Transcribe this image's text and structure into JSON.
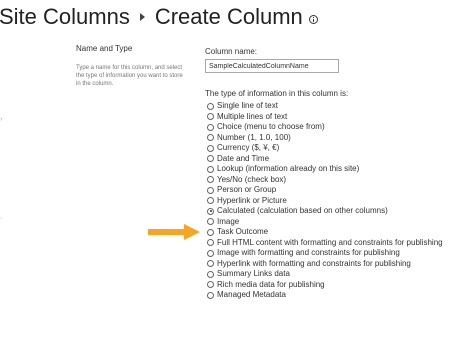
{
  "header": {
    "breadcrumb_root": "Site Columns",
    "page_title": "Create Column"
  },
  "section": {
    "title": "Name and Type",
    "description": "Type a name for this column, and select the type of information you want to store in the column."
  },
  "column_name": {
    "label": "Column name:",
    "value": "SampleCalculatedColumnName"
  },
  "type_question": "The type of information in this column is:",
  "type_options": [
    {
      "label": "Single line of text",
      "checked": false
    },
    {
      "label": "Multiple lines of text",
      "checked": false
    },
    {
      "label": "Choice (menu to choose from)",
      "checked": false
    },
    {
      "label": "Number (1, 1.0, 100)",
      "checked": false
    },
    {
      "label": "Currency ($, ¥, €)",
      "checked": false
    },
    {
      "label": "Date and Time",
      "checked": false
    },
    {
      "label": "Lookup (information already on this site)",
      "checked": false
    },
    {
      "label": "Yes/No (check box)",
      "checked": false
    },
    {
      "label": "Person or Group",
      "checked": false
    },
    {
      "label": "Hyperlink or Picture",
      "checked": false
    },
    {
      "label": "Calculated (calculation based on other columns)",
      "checked": true
    },
    {
      "label": "Image",
      "checked": false
    },
    {
      "label": "Task Outcome",
      "checked": false
    },
    {
      "label": "Full HTML content with formatting and constraints for publishing",
      "checked": false
    },
    {
      "label": "Image with formatting and constraints for publishing",
      "checked": false
    },
    {
      "label": "Hyperlink with formatting and constraints for publishing",
      "checked": false
    },
    {
      "label": "Summary Links data",
      "checked": false
    },
    {
      "label": "Rich media data for publishing",
      "checked": false
    },
    {
      "label": "Managed Metadata",
      "checked": false
    }
  ],
  "colors": {
    "arrow": "#f5a623",
    "text": "#333333",
    "muted": "#777777"
  }
}
